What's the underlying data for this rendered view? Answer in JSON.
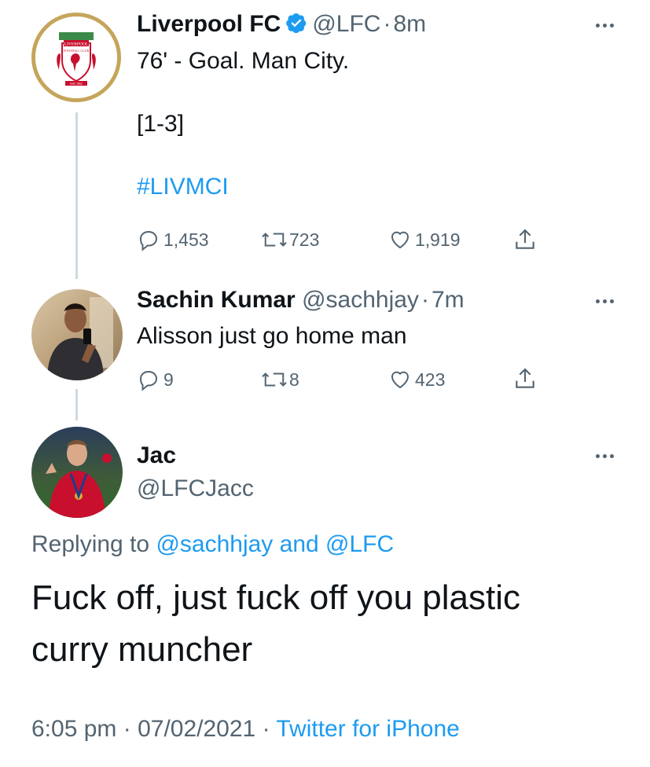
{
  "tweet1": {
    "name": "Liverpool FC",
    "handle": "@LFC",
    "sep": "·",
    "time": "8m",
    "line1": "76' - Goal. Man City.",
    "line2": "[1-3]",
    "hashtag": "#LIVMCI",
    "replies": "1,453",
    "retweets": "723",
    "likes": "1,919",
    "avatar_label": "LIVERPOOL",
    "avatar_sub": "FOOTBALL CLUB",
    "avatar_year": "EST 1892"
  },
  "tweet2": {
    "name": "Sachin Kumar",
    "handle": "@sachhjay",
    "sep": "·",
    "time": "7m",
    "text": "Alisson just go home man",
    "replies": "9",
    "retweets": "8",
    "likes": "423"
  },
  "tweet3": {
    "name": "Jac",
    "handle": "@LFCJacc",
    "replying_prefix": "Replying to",
    "replying_user1": "@sachhjay",
    "replying_and": "and",
    "replying_user2": "@LFC",
    "text_line1": "Fuck off, just fuck off you plastic",
    "text_line2": "curry muncher",
    "time": "6:05 pm",
    "sep1": "·",
    "date": "07/02/2021",
    "sep2": "·",
    "source": "Twitter for iPhone"
  },
  "colors": {
    "accent": "#1d9bf0",
    "muted": "#536471",
    "line": "#cfd9de",
    "lfc_gold": "#c5a55a",
    "lfc_red": "#c8102e"
  },
  "icons": [
    "verified-badge-icon",
    "more-icon",
    "reply-icon",
    "retweet-icon",
    "like-icon",
    "share-icon"
  ]
}
